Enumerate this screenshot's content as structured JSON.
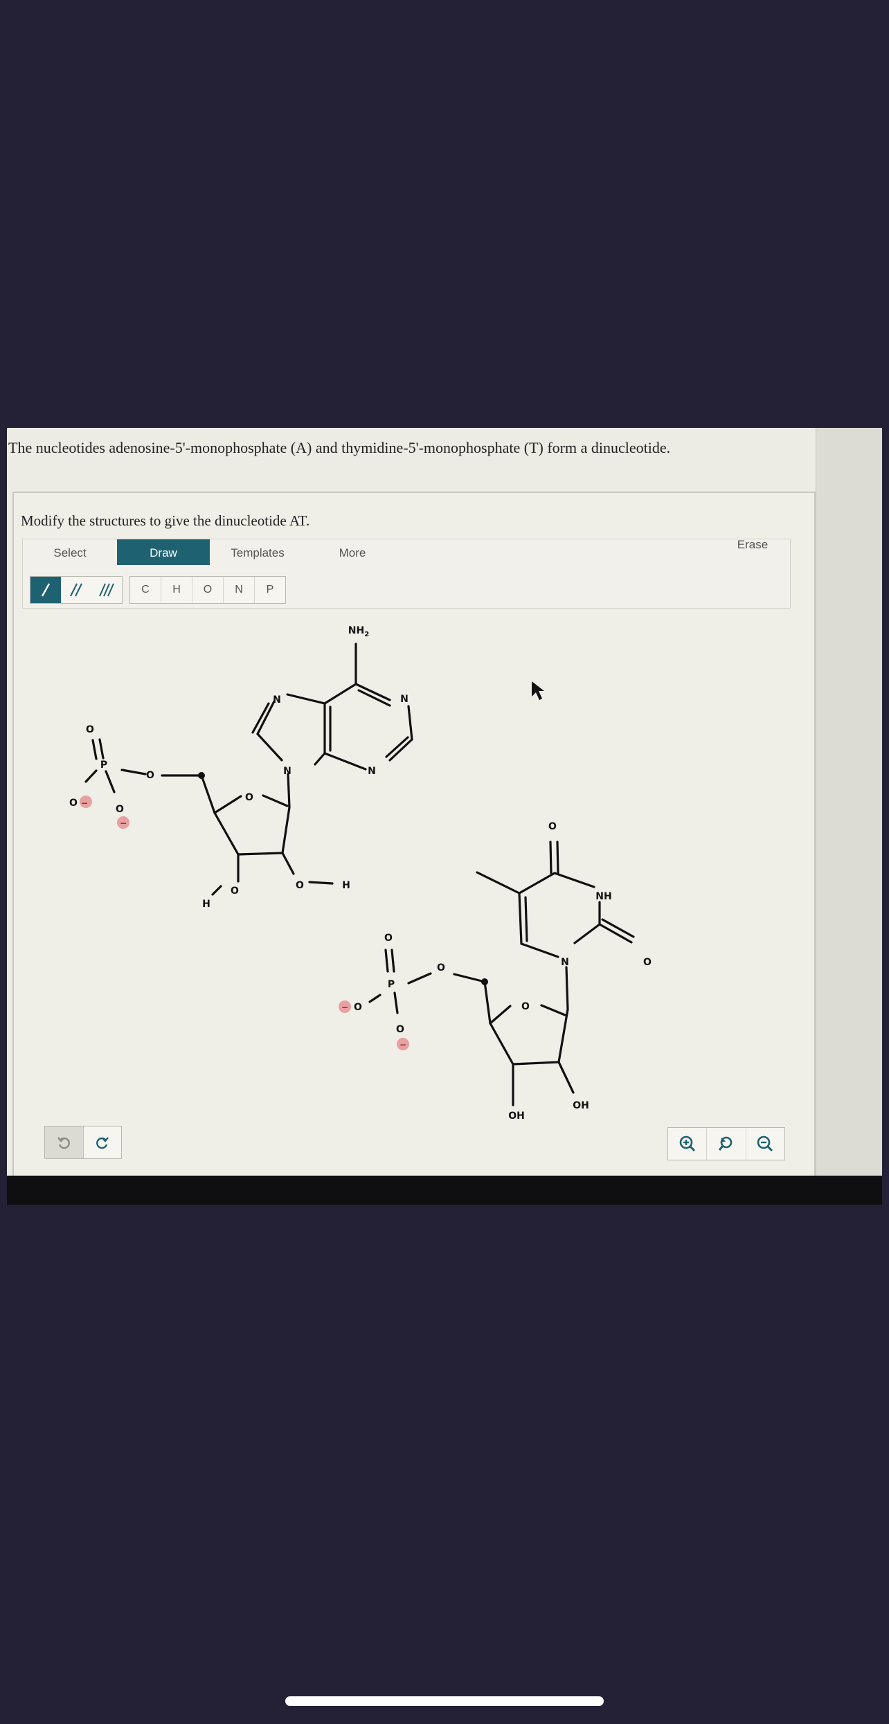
{
  "question": {
    "text": "The nucleotides adenosine-5'-monophosphate (A) and thymidine-5'-monophosphate (T) form a dinucleotide."
  },
  "panel": {
    "instruction": "Modify the structures to give the dinucleotide AT."
  },
  "tabs": {
    "select": "Select",
    "draw": "Draw",
    "templates": "Templates",
    "more": "More",
    "erase": "Erase"
  },
  "elements": [
    "C",
    "H",
    "O",
    "N",
    "P"
  ],
  "bond_tools": [
    {
      "icon": "single-bond-icon",
      "active": true
    },
    {
      "icon": "double-bond-icon",
      "active": false
    },
    {
      "icon": "triple-bond-icon",
      "active": false
    }
  ],
  "molecule_labels": {
    "nh2": "NH",
    "nh2_sub": "2",
    "n": "N",
    "o": "O",
    "p": "P",
    "h": "H",
    "nh": "NH",
    "oh": "OH",
    "minus": "−"
  },
  "colors": {
    "accent": "#1e6272",
    "background": "#242036",
    "charge": "#e8a0a0"
  }
}
